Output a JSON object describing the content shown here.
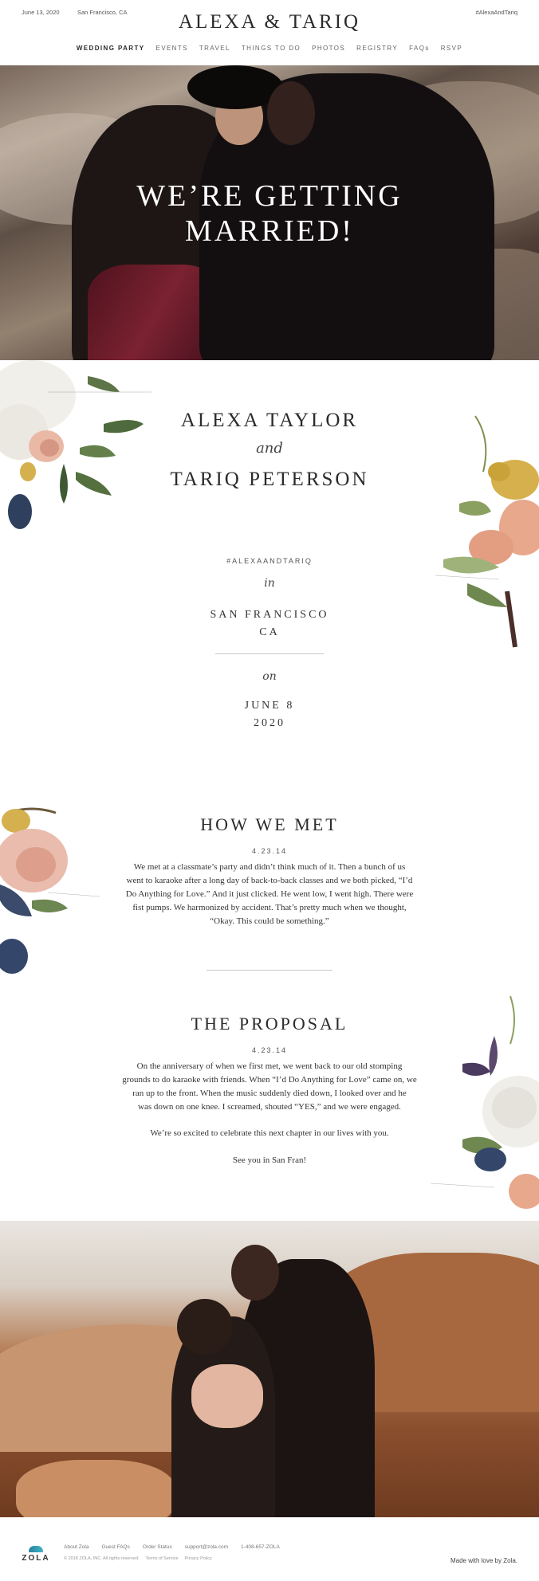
{
  "header": {
    "date": "June 13, 2020",
    "location": "San Francisco, CA",
    "hashtag": "#AlexaAndTariq",
    "title": "ALEXA & TARIQ"
  },
  "nav": {
    "items": [
      {
        "label": "WEDDING PARTY",
        "active": true
      },
      {
        "label": "EVENTS"
      },
      {
        "label": "TRAVEL"
      },
      {
        "label": "THINGS TO DO"
      },
      {
        "label": "PHOTOS"
      },
      {
        "label": "REGISTRY"
      },
      {
        "label": "FAQs"
      },
      {
        "label": "RSVP"
      }
    ]
  },
  "hero": {
    "line1": "WE’RE GETTING",
    "line2": "MARRIED!"
  },
  "couple": {
    "name1": "ALEXA TAYLOR",
    "and": "and",
    "name2": "TARIQ PETERSON",
    "hashtag": "#ALEXAANDTARIQ",
    "in_label": "in",
    "city": "SAN FRANCISCO",
    "state": "CA",
    "on_label": "on",
    "date_line1": "JUNE 8",
    "date_line2": "2020"
  },
  "how_we_met": {
    "title": "HOW WE MET",
    "date": "4.23.14",
    "lines": [
      "We met at a classmate’s party and didn’t think much of it. Then a bunch of us",
      "went to karaoke after a long day of back-to-back classes and we both picked, “I’d",
      "Do Anything for Love.” And it just clicked. He went low, I went high. There were",
      "fist pumps. We harmonized by accident. That’s pretty much when we thought,",
      "“Okay. This could be something.”"
    ]
  },
  "proposal": {
    "title": "THE PROPOSAL",
    "date": "4.23.14",
    "lines": [
      "On the anniversary of when we first met, we went back to our old stomping",
      "grounds to do karaoke with friends. When “I’d Do Anything for Love” came on, we",
      "ran up to the front. When the music suddenly died down, I looked over and he",
      "was down on one knee. I screamed, shouted “YES,” and we were engaged."
    ],
    "line2": "We’re so excited to celebrate this next chapter in our lives with you.",
    "line3": "See you in San Fran!"
  },
  "footer": {
    "logo": "ZOLA",
    "links": [
      "About Zola",
      "Guest FAQs",
      "Order Status",
      "support@zola.com",
      "1-408-657-ZOLA"
    ],
    "legal": [
      "© 2018 ZOLA, INC. All rights reserved.",
      "Terms of Service",
      "Privacy Policy"
    ],
    "made_with": "Made with love by Zola."
  },
  "colors": {
    "text": "#2b2b2b",
    "rule": "#c8c8c8",
    "zola_accent": "#3fb6c7"
  }
}
